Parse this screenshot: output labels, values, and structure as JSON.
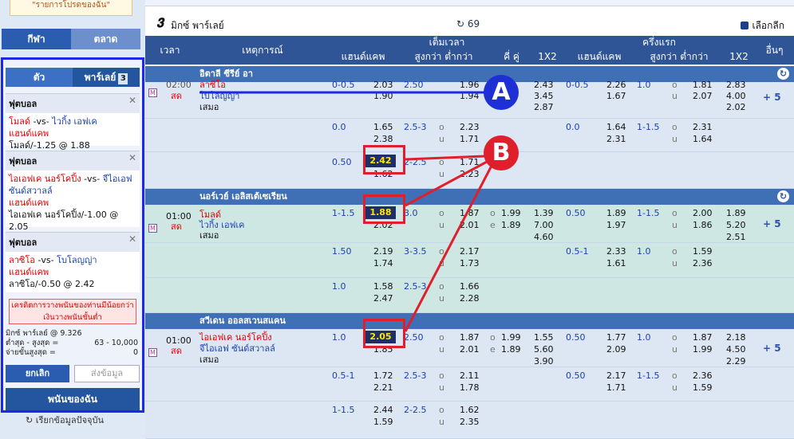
{
  "left": {
    "favorites_text": "\"รายการโปรดของฉัน\"",
    "tabs": [
      "กีฬา",
      "ตลาด"
    ],
    "slip_tabs": [
      "ตัว",
      "พาร์เลย์"
    ],
    "slip_count": "3",
    "bets": [
      {
        "sport": "ฟุตบอล",
        "match_a": "โมลด์",
        "vs": "-vs-",
        "match_b": "ไวกิ้ง เอฟเค",
        "market": "แฮนด์แคพ",
        "selection": "โมลด์/-1.25 @ 1.88"
      },
      {
        "sport": "ฟุตบอล",
        "match_a": "ไอเอฟเค นอร์โคปิ้ง",
        "vs": "-vs-",
        "match_b": "จีไอเอฟ ซันด์สวาลล์",
        "market": "แฮนด์แคพ",
        "selection": "ไอเอฟเค นอร์โคปิ้ง/-1.00 @ 2.05"
      },
      {
        "sport": "ฟุตบอล",
        "match_a": "ลาซิโอ",
        "vs": "-vs-",
        "match_b": "โบโลญญ่า",
        "market": "แฮนด์แคพ",
        "selection": "ลาซิโอ/-0.50 @ 2.42"
      }
    ],
    "warning": "เครดิตการวางพนันของท่านมีน้อยกว่าเงินวางพนันขั้นต่ำ",
    "mix_label": "มิกซ์ พาร์เลย์ @ 9.326",
    "minmax_label": "ต่ำสุด - สูงสุด =",
    "minmax_value": "63 - 10,000",
    "payout_label": "จ่ายขั้นสูงสุด =",
    "payout_value": "0",
    "cancel": "ยกเลิก",
    "submit": "ส่งข้อมูล",
    "my_bets": "พนันของฉัน",
    "refresh": "เรียกข้อมูลปัจจุบัน"
  },
  "header": {
    "title": "มิกซ์ พาร์เลย์",
    "count": "69",
    "league_select": "เลือกลีก"
  },
  "columns": {
    "time": "เวลา",
    "event": "เหตุการณ์",
    "fulltime": "เต็มเวลา",
    "firsthalf": "ครึ่งแรก",
    "more": "อื่นๆ",
    "handicap": "แฮนด์แคพ",
    "ou": "สูงกว่า ต่ำกว่า",
    "oe": "คี่ คู่",
    "x12": "1X2",
    "handicap2": "แฮนด์แคพ",
    "ou2": "สูงกว่า ต่ำกว่า",
    "x12b": "1X2"
  },
  "leagues": [
    {
      "name": "อิตาลี ซีรีย์ อา",
      "match": {
        "time": "02:00",
        "live": "สด",
        "home": "ลาซิโอ",
        "away": "โบโลญญ่า",
        "draw": "เสมอ",
        "more": "+ 5",
        "ft_rows": [
          {
            "hdp": "0-0.5",
            "h1": "2.03",
            "h2": "1.90",
            "ou": "2.50",
            "o": "1.96",
            "u": "1.94",
            "x1": "2.43",
            "x2": "3.45",
            "x3": "2.87"
          },
          {
            "hdp": "0.0",
            "h1": "1.65",
            "h2": "2.38",
            "ou": "2.5-3",
            "o": "2.23",
            "u": "1.71"
          },
          {
            "hdp": "0.50",
            "h1": "2.42",
            "h2": "1.62",
            "ou": "2-2.5",
            "o": "1.71",
            "u": "2.23"
          }
        ],
        "fh_rows": [
          {
            "hdp": "0-0.5",
            "h1": "2.26",
            "h2": "1.67",
            "ou": "1.0",
            "o": "1.81",
            "u": "2.07",
            "x1": "2.83",
            "x2": "4.00",
            "x3": "2.02"
          },
          {
            "hdp": "0.0",
            "h1": "1.64",
            "h2": "2.31",
            "ou": "1-1.5",
            "o": "2.31",
            "u": "1.64"
          }
        ]
      }
    },
    {
      "name": "นอร์เวย์ เอลิสเต้เซเรียน",
      "match": {
        "time": "01:00",
        "live": "สด",
        "home": "โมลด์",
        "away": "ไวกิ้ง เอฟเค",
        "draw": "เสมอ",
        "more": "+ 5",
        "ft_rows": [
          {
            "hdp": "1-1.5",
            "h1": "1.88",
            "h2": "2.02",
            "ou": "3.0",
            "o": "1.87",
            "u": "2.01",
            "oe_o": "1.99",
            "oe_e": "1.89",
            "x1": "1.39",
            "x2": "7.00",
            "x3": "4.60"
          },
          {
            "hdp": "1.50",
            "h1": "2.19",
            "h2": "1.74",
            "ou": "3-3.5",
            "o": "2.17",
            "u": "1.73"
          },
          {
            "hdp": "1.0",
            "h1": "1.58",
            "h2": "2.47",
            "ou": "2.5-3",
            "o": "1.66",
            "u": "2.28"
          }
        ],
        "fh_rows": [
          {
            "hdp": "0.50",
            "h1": "1.89",
            "h2": "1.97",
            "ou": "1-1.5",
            "o": "2.00",
            "u": "1.86",
            "x1": "1.89",
            "x2": "5.20",
            "x3": "2.51"
          },
          {
            "hdp": "0.5-1",
            "h1": "2.33",
            "h2": "1.61",
            "ou": "1.0",
            "o": "1.59",
            "u": "2.36"
          }
        ]
      }
    },
    {
      "name": "สวีเดน ออลสเวนสแคน",
      "match": {
        "time": "01:00",
        "live": "สด",
        "home": "ไอเอฟเค นอร์โคปิ้ง",
        "away": "จีไอเอฟ ซันด์สวาลล์",
        "draw": "เสมอ",
        "more": "+ 5",
        "ft_rows": [
          {
            "hdp": "1.0",
            "h1": "2.05",
            "h2": "1.85",
            "ou": "2.50",
            "o": "1.87",
            "u": "2.01",
            "oe_o": "1.99",
            "oe_e": "1.89",
            "x1": "1.55",
            "x2": "5.60",
            "x3": "3.90"
          },
          {
            "hdp": "0.5-1",
            "h1": "1.72",
            "h2": "2.21",
            "ou": "2.5-3",
            "o": "2.11",
            "u": "1.78"
          },
          {
            "hdp": "1-1.5",
            "h1": "2.44",
            "h2": "1.59",
            "ou": "2-2.5",
            "o": "1.62",
            "u": "2.35"
          }
        ],
        "fh_rows": [
          {
            "hdp": "0.50",
            "h1": "1.77",
            "h2": "2.09",
            "ou": "1.0",
            "o": "1.87",
            "u": "1.99",
            "x1": "2.18",
            "x2": "4.50",
            "x3": "2.29"
          },
          {
            "hdp": "0.50",
            "h1": "2.17",
            "h2": "1.71",
            "ou": "1-1.5",
            "o": "2.36",
            "u": "1.59"
          }
        ]
      }
    }
  ],
  "ou_o": "o",
  "ou_u": "u",
  "oe_o_mark": "o",
  "oe_e_mark": "e",
  "markers": {
    "a": "A",
    "b": "B"
  }
}
